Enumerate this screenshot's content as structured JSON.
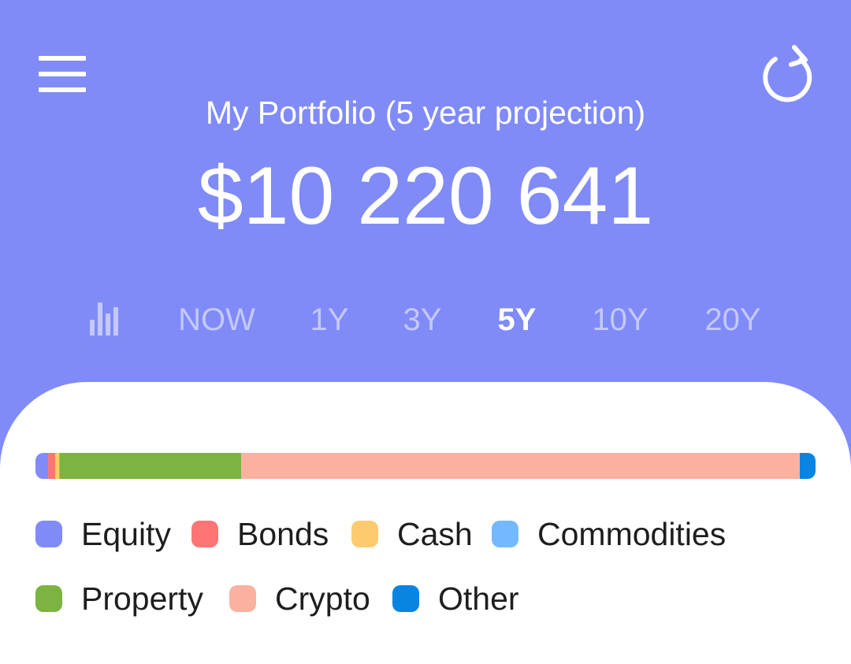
{
  "header": {
    "title": "My Portfolio (5 year projection)",
    "total_value": "$10 220 641",
    "background_color": "#808BF8",
    "menu_icon": "hamburger-menu-icon",
    "refresh_icon": "refresh-icon",
    "chart_toggle_icon": "bar-chart-icon"
  },
  "time_ranges": {
    "selected": "5Y",
    "tabs": [
      {
        "label": "NOW"
      },
      {
        "label": "1Y"
      },
      {
        "label": "3Y"
      },
      {
        "label": "5Y"
      },
      {
        "label": "10Y"
      },
      {
        "label": "20Y"
      }
    ]
  },
  "allocation": {
    "segments": [
      {
        "name": "Equity",
        "color": "#808BF8",
        "share_percent": 1.6
      },
      {
        "name": "Bonds",
        "color": "#FF7475",
        "share_percent": 0.9
      },
      {
        "name": "Cash",
        "color": "#FDCB6E",
        "share_percent": 0.5
      },
      {
        "name": "Commodities",
        "color": "#74B9FF",
        "share_percent": 0.1
      },
      {
        "name": "Property",
        "color": "#7CB342",
        "share_percent": 23.3
      },
      {
        "name": "Crypto",
        "color": "#FAB1A0",
        "share_percent": 71.6
      },
      {
        "name": "Other",
        "color": "#0984E3",
        "share_percent": 2.0
      }
    ]
  },
  "legend": {
    "rows": [
      [
        {
          "label": "Equity",
          "color": "#808BF8"
        },
        {
          "label": "Bonds",
          "color": "#FF7475"
        },
        {
          "label": "Cash",
          "color": "#FDCB6E"
        },
        {
          "label": "Commodities",
          "color": "#74B9FF"
        }
      ],
      [
        {
          "label": "Property",
          "color": "#7CB342"
        },
        {
          "label": "Crypto",
          "color": "#FAB1A0"
        },
        {
          "label": "Other",
          "color": "#0984E3"
        }
      ]
    ]
  }
}
